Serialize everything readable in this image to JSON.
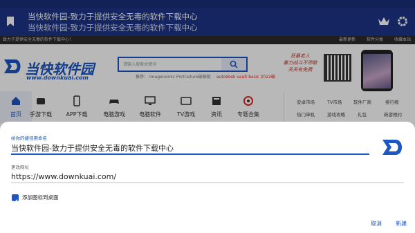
{
  "browser": {
    "title": "当快软件园-致力于提供安全无毒的软件下载中心",
    "subtitle": "当快软件园-致力于提供安全无毒的软件下载中心"
  },
  "site": {
    "topbar": {
      "left_text": "致力于提供安全无毒的软件下载中心！",
      "links": [
        "最新更新",
        "软件分类",
        "收藏本站"
      ]
    },
    "logo_name": "当快软件园",
    "logo_domain": "www.downkuai.com",
    "search_placeholder": "请输入搜索关键词",
    "hot_label": "推荐：",
    "hot_1": "Imagenomic Portraiture破解版",
    "hot_2": "autodesk vault basic 2022破",
    "ad_line1": "狂暴老人",
    "ad_line2": "暴力战斗不停歇",
    "ad_line3": "天天有免费",
    "nav": [
      {
        "label": "首页",
        "icon": "home-icon"
      },
      {
        "label": "手游下载",
        "icon": "gamepad-icon"
      },
      {
        "label": "APP下载",
        "icon": "phone-icon"
      },
      {
        "label": "电脑游戏",
        "icon": "controller-icon"
      },
      {
        "label": "电脑软件",
        "icon": "monitor-icon"
      },
      {
        "label": "TV游戏",
        "icon": "tv-icon"
      },
      {
        "label": "资讯",
        "icon": "news-icon"
      },
      {
        "label": "专题合集",
        "icon": "collection-icon"
      }
    ],
    "subnav_row1": [
      "安卓市场",
      "TV市场",
      "软件厂商",
      "排行榜"
    ],
    "subnav_row2": [
      "热门单机",
      "游戏攻略",
      "礼包",
      "新游预约"
    ]
  },
  "dialog": {
    "name_caption": "给你的捷径用命名",
    "name_value": "当快软件园-致力于提供安全无毒的软件下载中心",
    "url_caption": "更改网址",
    "url_value": "https://www.downkuai.com/",
    "checkbox_label": "添加图标到桌面",
    "checkbox_checked": true,
    "cancel_label": "取消",
    "create_label": "新建"
  },
  "colors": {
    "titlebar": "#1d3488",
    "accent": "#1c57c3",
    "hot_link": "#e0261c"
  }
}
